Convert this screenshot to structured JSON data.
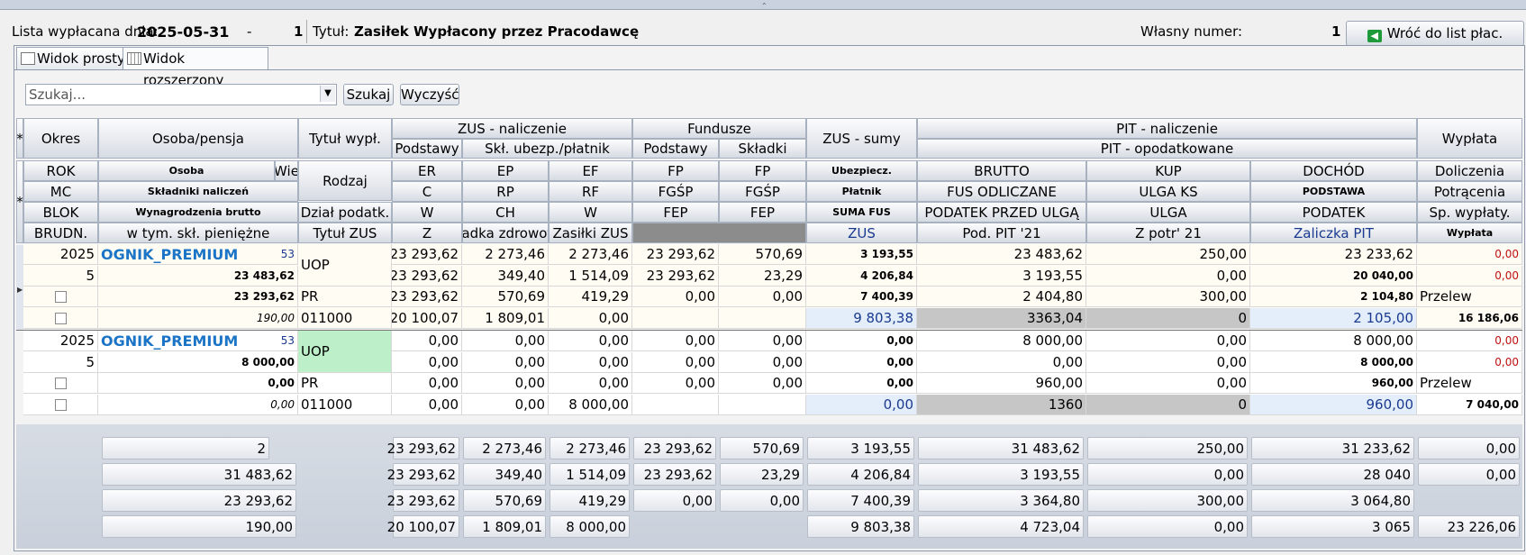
{
  "header": {
    "lista_label": "Lista wypłacana dnia:",
    "date": "2025-05-31",
    "dash": "-",
    "number": "1",
    "tytul_label": "Tytuł:",
    "tytul_value": "Zasiłek Wypłacony przez Pracodawcę",
    "wlasny_label": "Własny numer:",
    "wlasny_value": "1",
    "back_button": "Wróć do list płac."
  },
  "tabs": [
    {
      "label": "Widok prosty"
    },
    {
      "label": "Widok rozszerzony"
    }
  ],
  "search": {
    "placeholder": "Szukaj...",
    "search_button": "Szukaj",
    "clear_button": "Wyczyść"
  },
  "grid_header": {
    "top": {
      "star": "*",
      "okres": "Okres",
      "osoba": "Osoba/pensja",
      "tytul": "Tytuł wypł.",
      "zus_nal": "ZUS - naliczenie",
      "fundusze": "Fundusze",
      "zus_sumy": "ZUS - sumy",
      "pit_nal": "PIT - naliczenie",
      "pit_opod": "PIT - opodatkowane",
      "wyplata": "Wypłata",
      "podstawy": "Podstawy",
      "skl_ubezp": "Skł. ubezp./płatnik",
      "fp_podstawy": "Podstawy",
      "fp_skladki": "Składki"
    },
    "rows": [
      {
        "a": "ROK",
        "b": "Osoba",
        "b2": "Wie",
        "c": "Rodzaj",
        "d": "ER",
        "e": "EP",
        "f": "EF",
        "g": "FP",
        "h": "FP",
        "i": "Ubezpiecz.",
        "j": "BRUTTO",
        "k": "KUP",
        "l": "DOCHÓD",
        "m": "Doliczenia"
      },
      {
        "a": "MC",
        "b": "Składniki naliczeń",
        "d": "C",
        "e": "RP",
        "f": "RF",
        "g": "FGŚP",
        "h": "FGŚP",
        "i": "Płatnik",
        "j": "FUS ODLICZANE",
        "k": "ULGA KS",
        "l": "PODSTAWA",
        "m": "Potrącenia"
      },
      {
        "a": "BLOK",
        "b": "Wynagrodzenia brutto",
        "c": "Dział podatk.",
        "d": "W",
        "e": "CH",
        "f": "W",
        "g": "FEP",
        "h": "FEP",
        "i": "SUMA FUS",
        "j": "PODATEK PRZED ULGĄ",
        "k": "ULGA",
        "l": "PODATEK",
        "m": "Sp. wypłaty."
      },
      {
        "a": "BRUDN.",
        "b": "w tym. skł. pieniężne",
        "c": "Tytuł ZUS",
        "d": "Z",
        "e": "Składka zdrowotna",
        "f": "Zasiłki ZUS",
        "i": "ZUS",
        "j": "Pod. PIT '21",
        "k": "Z potr' 21",
        "l": "Zaliczka PIT",
        "m": "Wypłata"
      }
    ]
  },
  "records": [
    {
      "rok": "2025",
      "mc": "5",
      "name": "OGNIK_PREMIUM",
      "id": "53",
      "brutto_osoba": "23 483,62",
      "wyn_brutto": "23 293,62",
      "skl_pien": "190,00",
      "rodzaj": "UOP",
      "blok": "PR",
      "tytul_zus": "011000",
      "r1": [
        "23 293,62",
        "2 273,46",
        "2 273,46",
        "23 293,62",
        "570,69",
        "3 193,55",
        "23 483,62",
        "250,00",
        "23 233,62",
        "0,00"
      ],
      "r2": [
        "23 293,62",
        "349,40",
        "1 514,09",
        "23 293,62",
        "23,29",
        "4 206,84",
        "3 193,55",
        "0,00",
        "20 040,00",
        "0,00"
      ],
      "r3": [
        "23 293,62",
        "570,69",
        "419,29",
        "0,00",
        "0,00",
        "7 400,39",
        "2 404,80",
        "300,00",
        "2 104,80",
        "Przelew"
      ],
      "r4": [
        "20 100,07",
        "1 809,01",
        "0,00",
        "",
        "",
        "9 803,38",
        "3363,04",
        "0",
        "2 105,00",
        "16 186,06"
      ]
    },
    {
      "rok": "2025",
      "mc": "5",
      "name": "OGNIK_PREMIUM",
      "id": "53",
      "brutto_osoba": "8 000,00",
      "wyn_brutto": "0,00",
      "skl_pien": "0,00",
      "rodzaj": "UOP",
      "blok": "PR",
      "tytul_zus": "011000",
      "r1": [
        "0,00",
        "0,00",
        "0,00",
        "0,00",
        "0,00",
        "0,00",
        "8 000,00",
        "0,00",
        "8 000,00",
        "0,00"
      ],
      "r2": [
        "0,00",
        "0,00",
        "0,00",
        "0,00",
        "0,00",
        "0,00",
        "0,00",
        "0,00",
        "8 000,00",
        "0,00"
      ],
      "r3": [
        "0,00",
        "0,00",
        "0,00",
        "0,00",
        "0,00",
        "0,00",
        "960,00",
        "0,00",
        "960,00",
        "Przelew"
      ],
      "r4": [
        "0,00",
        "0,00",
        "8 000,00",
        "",
        "",
        "0,00",
        "1360",
        "0",
        "960,00",
        "7 040,00"
      ]
    }
  ],
  "totals": [
    {
      "a": "2",
      "v": [
        "23 293,62",
        "2 273,46",
        "2 273,46",
        "23 293,62",
        "570,69",
        "3 193,55",
        "31 483,62",
        "250,00",
        "31 233,62",
        "0,00"
      ]
    },
    {
      "a": "31 483,62",
      "v": [
        "23 293,62",
        "349,40",
        "1 514,09",
        "23 293,62",
        "23,29",
        "4 206,84",
        "3 193,55",
        "0,00",
        "28 040",
        "0,00"
      ]
    },
    {
      "a": "23 293,62",
      "v": [
        "23 293,62",
        "570,69",
        "419,29",
        "0,00",
        "0,00",
        "7 400,39",
        "3 364,80",
        "300,00",
        "3 064,80",
        ""
      ]
    },
    {
      "a": "190,00",
      "v": [
        "20 100,07",
        "1 809,01",
        "8 000,00",
        "",
        "",
        "9 803,38",
        "4 723,04",
        "0,00",
        "3 065",
        "23 226,06"
      ]
    }
  ]
}
